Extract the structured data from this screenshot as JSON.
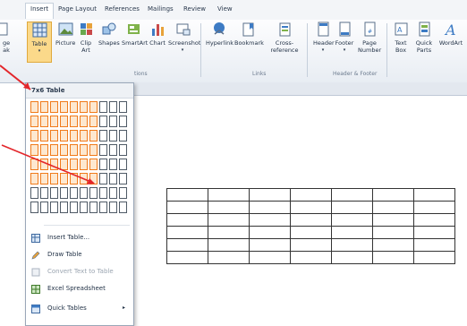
{
  "tabs": [
    "Insert",
    "Page Layout",
    "References",
    "Mailings",
    "Review",
    "View"
  ],
  "ribbon": {
    "buttons": [
      "ge\nak",
      "Table",
      "Picture",
      "Clip\nArt",
      "Shapes",
      "SmartArt",
      "Chart",
      "Screenshot",
      "Hyperlink",
      "Bookmark",
      "Cross-reference",
      "Header",
      "Footer",
      "Page\nNumber",
      "Text\nBox",
      "Quick\nParts",
      "WordArt"
    ],
    "groups": [
      "tions",
      "Links",
      "Header & Footer"
    ]
  },
  "table_menu": {
    "title": "7x6 Table",
    "grid_cols": 10,
    "grid_rows": 8,
    "selected_cols": 7,
    "selected_rows": 6,
    "items": [
      {
        "label": "Insert Table...",
        "disabled": false
      },
      {
        "label": "Draw Table",
        "disabled": false
      },
      {
        "label": "Convert Text to Table",
        "disabled": true
      },
      {
        "label": "Excel Spreadsheet",
        "disabled": false
      },
      {
        "label": "Quick Tables",
        "disabled": false
      }
    ],
    "submenu_arrow": "▸"
  },
  "document_table": {
    "rows": 6,
    "cols": 7
  },
  "colors": {
    "selection_border": "#f07a1a",
    "selection_fill": "#fde8d0",
    "arrow": "#e3262b"
  }
}
